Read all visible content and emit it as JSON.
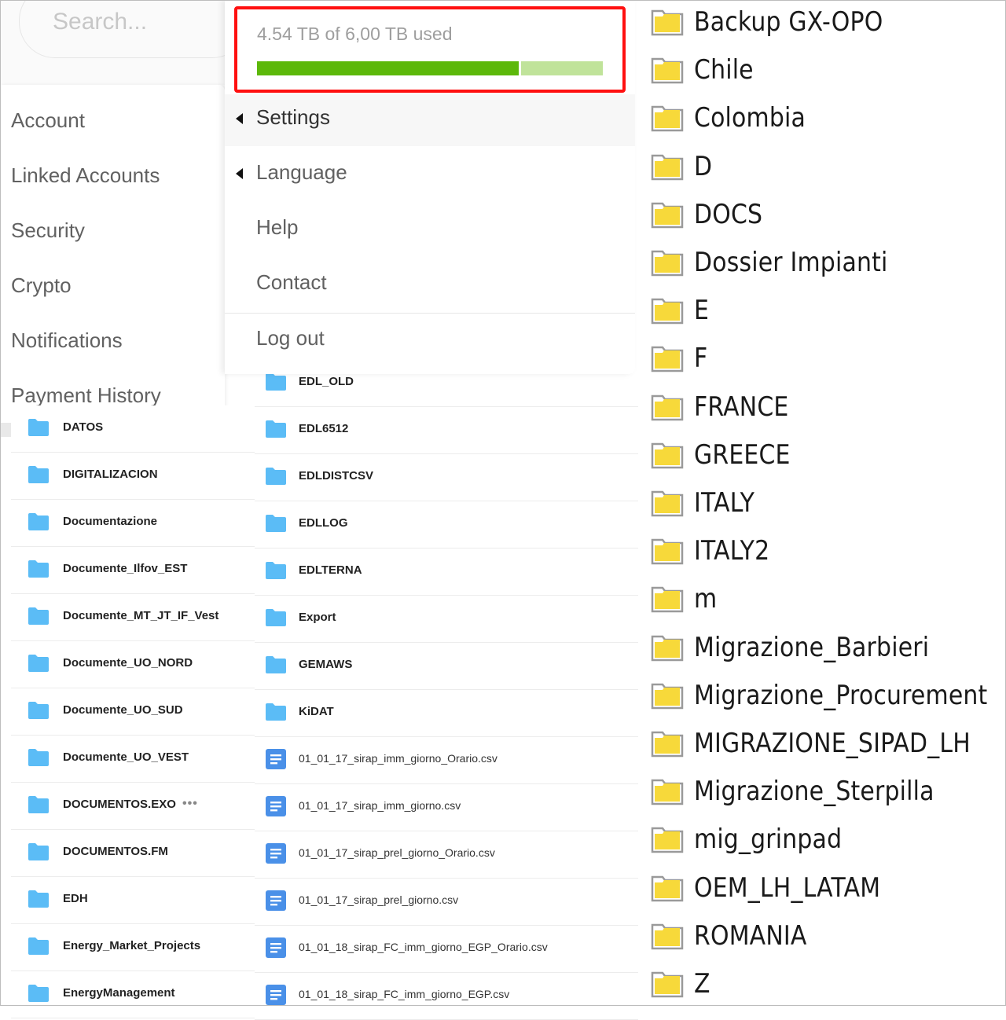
{
  "search": {
    "placeholder": "Search..."
  },
  "account_menu": {
    "items": [
      {
        "label": "Account"
      },
      {
        "label": "Linked Accounts"
      },
      {
        "label": "Security"
      },
      {
        "label": "Crypto"
      },
      {
        "label": "Notifications"
      },
      {
        "label": "Payment History"
      }
    ]
  },
  "storage": {
    "text": "4.54 TB of 6,00 TB used",
    "used_tb": 4.54,
    "total_tb": 6.0,
    "used_fraction": 0.757,
    "used_color": "#5cb80a",
    "free_color": "#c0e39a",
    "highlight_color": "#ff1010"
  },
  "dropdown": {
    "items": [
      {
        "label": "Settings",
        "has_submenu": true,
        "active": true
      },
      {
        "label": "Language",
        "has_submenu": true,
        "active": false
      },
      {
        "label": "Help",
        "has_submenu": false,
        "active": false
      },
      {
        "label": "Contact",
        "has_submenu": false,
        "active": false
      },
      {
        "label": "Log out",
        "has_submenu": false,
        "active": false
      }
    ]
  },
  "web_list_left": {
    "items": [
      {
        "name": "DATOS",
        "type": "folder"
      },
      {
        "name": "DIGITALIZACION",
        "type": "folder"
      },
      {
        "name": "Documentazione",
        "type": "folder"
      },
      {
        "name": "Documente_Ilfov_EST",
        "type": "folder"
      },
      {
        "name": "Documente_MT_JT_IF_Vest",
        "type": "folder"
      },
      {
        "name": "Documente_UO_NORD",
        "type": "folder"
      },
      {
        "name": "Documente_UO_SUD",
        "type": "folder"
      },
      {
        "name": "Documente_UO_VEST",
        "type": "folder"
      },
      {
        "name": "DOCUMENTOS.EXO",
        "type": "folder",
        "more": "•••"
      },
      {
        "name": "DOCUMENTOS.FM",
        "type": "folder"
      },
      {
        "name": "EDH",
        "type": "folder"
      },
      {
        "name": "Energy_Market_Projects",
        "type": "folder"
      },
      {
        "name": "EnergyManagement",
        "type": "folder"
      }
    ]
  },
  "web_list_mid": {
    "items": [
      {
        "name": "EDL_OLD",
        "type": "folder"
      },
      {
        "name": "EDL6512",
        "type": "folder"
      },
      {
        "name": "EDLDISTCSV",
        "type": "folder"
      },
      {
        "name": "EDLLOG",
        "type": "folder"
      },
      {
        "name": "EDLTERNA",
        "type": "folder"
      },
      {
        "name": "Export",
        "type": "folder"
      },
      {
        "name": "GEMAWS",
        "type": "folder"
      },
      {
        "name": "KiDAT",
        "type": "folder"
      },
      {
        "name": "01_01_17_sirap_imm_giorno_Orario.csv",
        "type": "file"
      },
      {
        "name": "01_01_17_sirap_imm_giorno.csv",
        "type": "file"
      },
      {
        "name": "01_01_17_sirap_prel_giorno_Orario.csv",
        "type": "file"
      },
      {
        "name": "01_01_17_sirap_prel_giorno.csv",
        "type": "file"
      },
      {
        "name": "01_01_18_sirap_FC_imm_giorno_EGP_Orario.csv",
        "type": "file"
      },
      {
        "name": "01_01_18_sirap_FC_imm_giorno_EGP.csv",
        "type": "file"
      }
    ]
  },
  "explorer_list": {
    "items": [
      {
        "name": "Backup GX-OPO"
      },
      {
        "name": "Chile"
      },
      {
        "name": "Colombia"
      },
      {
        "name": "D"
      },
      {
        "name": "DOCS"
      },
      {
        "name": "Dossier Impianti"
      },
      {
        "name": "E"
      },
      {
        "name": "F"
      },
      {
        "name": "FRANCE"
      },
      {
        "name": "GREECE"
      },
      {
        "name": "ITALY"
      },
      {
        "name": "ITALY2"
      },
      {
        "name": "m"
      },
      {
        "name": "Migrazione_Barbieri"
      },
      {
        "name": "Migrazione_Procurement"
      },
      {
        "name": "MIGRAZIONE_SIPAD_LH"
      },
      {
        "name": "Migrazione_Sterpilla"
      },
      {
        "name": "mig_grinpad"
      },
      {
        "name": "OEM_LH_LATAM"
      },
      {
        "name": "ROMANIA"
      },
      {
        "name": "Z"
      }
    ]
  },
  "colors": {
    "web_folder": "#5bbcf6",
    "web_file": "#4a90e8",
    "win_folder": "#f7d93a"
  }
}
